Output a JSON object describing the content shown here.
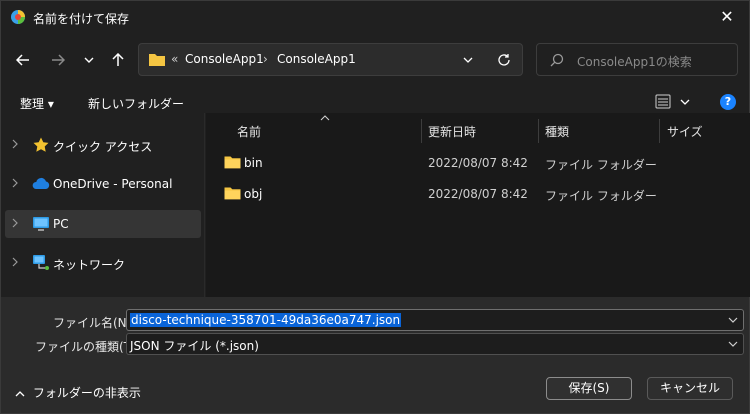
{
  "window": {
    "title": "名前を付けて保存",
    "close_glyph": "✕"
  },
  "address": {
    "overflow": "«",
    "crumbs": [
      "ConsoleApp1",
      "ConsoleApp1"
    ],
    "separator": "›"
  },
  "search": {
    "placeholder": "ConsoleApp1の検索"
  },
  "commands": {
    "organize": "整理 ▾",
    "new_folder": "新しいフォルダー",
    "help": "?"
  },
  "sidebar": {
    "items": [
      {
        "label": "クイック アクセス",
        "icon": "star-icon"
      },
      {
        "label": "OneDrive - Personal",
        "icon": "cloud-icon"
      },
      {
        "label": "PC",
        "icon": "monitor-icon",
        "selected": true
      },
      {
        "label": "ネットワーク",
        "icon": "network-icon"
      }
    ]
  },
  "columns": {
    "name": "名前",
    "date": "更新日時",
    "type": "種類",
    "size": "サイズ"
  },
  "files": [
    {
      "name": "bin",
      "date": "2022/08/07 8:42",
      "type": "ファイル フォルダー"
    },
    {
      "name": "obj",
      "date": "2022/08/07 8:42",
      "type": "ファイル フォルダー"
    }
  ],
  "form": {
    "filename_label": "ファイル名(N):",
    "filename_value": "disco-technique-358701-49da36e0a747.json",
    "filetype_label": "ファイルの種類(T):",
    "filetype_value": "JSON ファイル (*.json)"
  },
  "footer": {
    "hide_folders": "フォルダーの非表示",
    "save": "保存(S)",
    "cancel": "キャンセル"
  },
  "colors": {
    "accent": "#0a64d8",
    "folder": "#f4c542",
    "help": "#1a83ff"
  }
}
